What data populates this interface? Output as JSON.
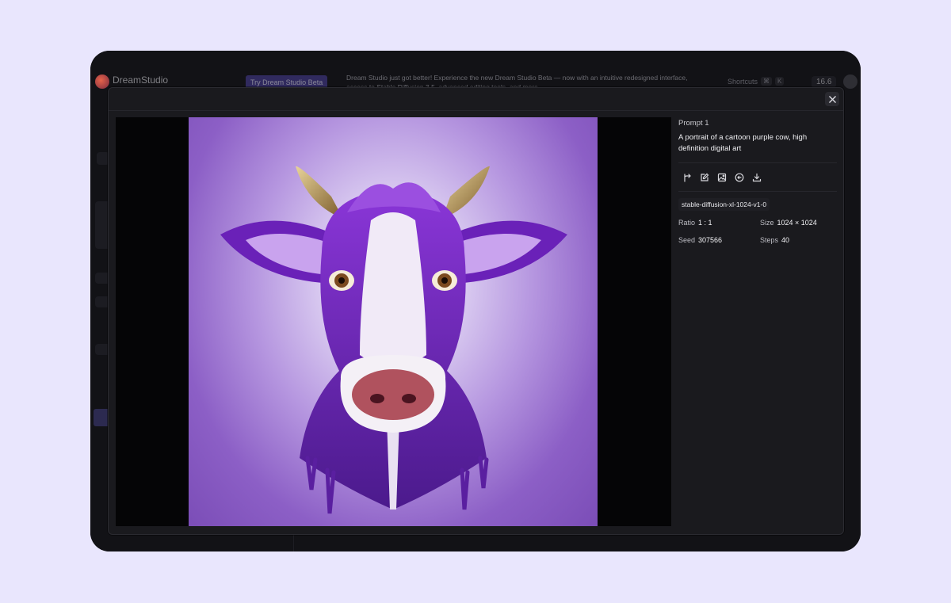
{
  "background_app": {
    "brand": "DreamStudio",
    "beta_button": "Try Dream Studio Beta",
    "banner": "Dream Studio just got better! Experience the new Dream Studio Beta — now with an intuitive redesigned interface, access to Stable Diffusion 3.5, advanced editing tools, and more.",
    "shortcuts_label": "Shortcuts",
    "shortcut_keys": [
      "⌘",
      "K"
    ],
    "credits": "16.6"
  },
  "modal": {
    "close_icon": "close-icon",
    "image_alt": "A portrait of a cartoon purple cow, high definition digital art",
    "prompt_label": "Prompt 1",
    "prompt_text": "A portrait of a cartoon purple cow, high definition digital art",
    "actions": [
      {
        "name": "branch-icon"
      },
      {
        "name": "edit-icon"
      },
      {
        "name": "image-icon"
      },
      {
        "name": "back-circle-icon"
      },
      {
        "name": "download-icon"
      }
    ],
    "model": "stable-diffusion-xl-1024-v1-0",
    "meta": {
      "ratio_label": "Ratio",
      "ratio_value": "1 : 1",
      "size_label": "Size",
      "size_value": "1024 × 1024",
      "seed_label": "Seed",
      "seed_value": "307566",
      "steps_label": "Steps",
      "steps_value": "40"
    }
  },
  "colors": {
    "page_bg": "#e9e6fd",
    "modal_bg": "#1a1a1e",
    "accent": "#4a3f9a"
  }
}
